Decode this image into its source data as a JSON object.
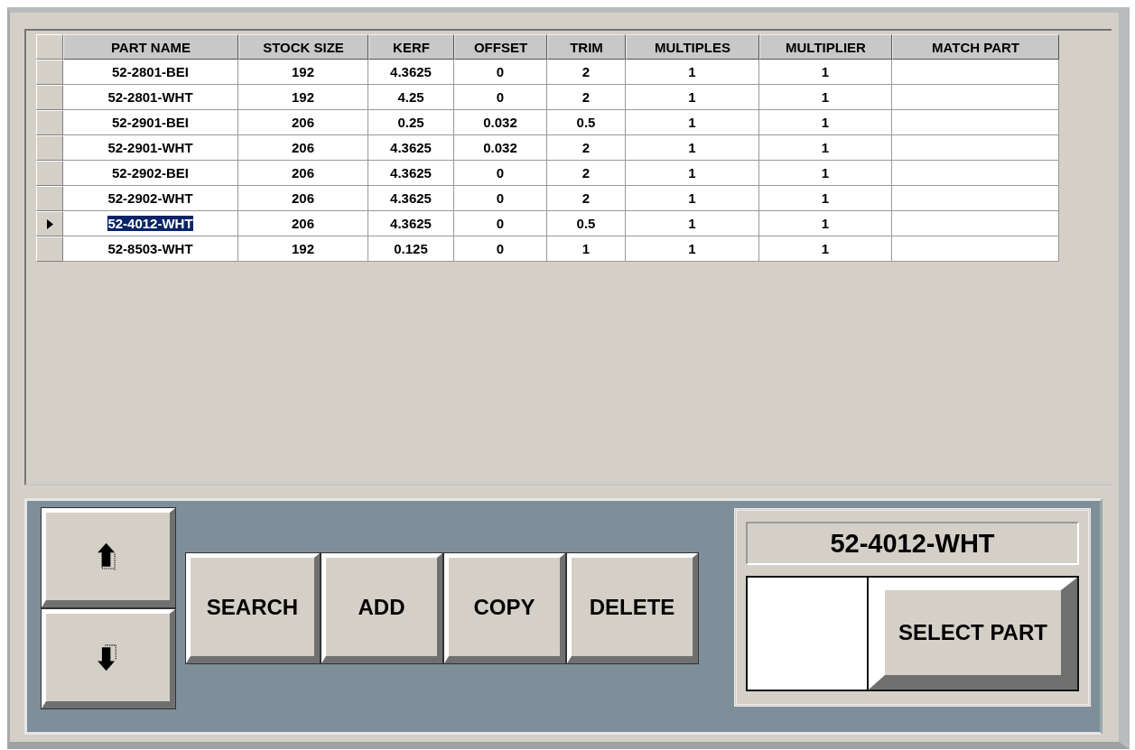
{
  "table": {
    "columns": [
      "PART NAME",
      "STOCK SIZE",
      "KERF",
      "OFFSET",
      "TRIM",
      "MULTIPLES",
      "MULTIPLIER",
      "MATCH PART"
    ],
    "rows": [
      {
        "selected": false,
        "cells": [
          "52-2801-BEI",
          "192",
          "4.3625",
          "0",
          "2",
          "1",
          "1"
        ]
      },
      {
        "selected": false,
        "cells": [
          "52-2801-WHT",
          "192",
          "4.25",
          "0",
          "2",
          "1",
          "1"
        ]
      },
      {
        "selected": false,
        "cells": [
          "52-2901-BEI",
          "206",
          "0.25",
          "0.032",
          "0.5",
          "1",
          "1"
        ]
      },
      {
        "selected": false,
        "cells": [
          "52-2901-WHT",
          "206",
          "4.3625",
          "0.032",
          "2",
          "1",
          "1"
        ]
      },
      {
        "selected": false,
        "cells": [
          "52-2902-BEI",
          "206",
          "4.3625",
          "0",
          "2",
          "1",
          "1"
        ]
      },
      {
        "selected": false,
        "cells": [
          "52-2902-WHT",
          "206",
          "4.3625",
          "0",
          "2",
          "1",
          "1"
        ]
      },
      {
        "selected": true,
        "cells": [
          "52-4012-WHT",
          "206",
          "4.3625",
          "0",
          "0.5",
          "1",
          "1"
        ]
      },
      {
        "selected": false,
        "cells": [
          "52-8503-WHT",
          "192",
          "0.125",
          "0",
          "1",
          "1",
          "1"
        ]
      }
    ]
  },
  "actions": [
    "SEARCH",
    "ADD",
    "COPY",
    "DELETE"
  ],
  "selected_part": {
    "display": "52-4012-WHT",
    "button": "SELECT PART"
  }
}
